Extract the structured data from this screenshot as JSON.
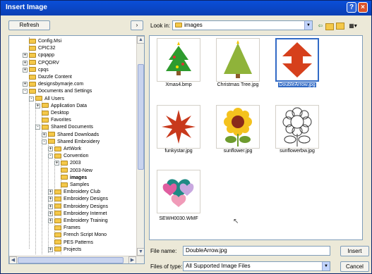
{
  "window": {
    "title": "Insert Image",
    "help_glyph": "?",
    "close_glyph": "×"
  },
  "left": {
    "refresh_label": "Refresh",
    "arrow_glyph": "›"
  },
  "lookin": {
    "label": "Look in:",
    "value": "images"
  },
  "tree": [
    {
      "label": "Config.Msi",
      "indent": 4,
      "expander": ""
    },
    {
      "label": "CPIC32",
      "indent": 4,
      "expander": ""
    },
    {
      "label": "cpqapp",
      "indent": 4,
      "expander": "+"
    },
    {
      "label": "CPQDRV",
      "indent": 4,
      "expander": "+"
    },
    {
      "label": "cpqs",
      "indent": 4,
      "expander": "+"
    },
    {
      "label": "Dazzle Content",
      "indent": 4,
      "expander": ""
    },
    {
      "label": "designsbymarje.com",
      "indent": 4,
      "expander": "+"
    },
    {
      "label": "Documents and Settings",
      "indent": 4,
      "expander": "-"
    },
    {
      "label": "All Users",
      "indent": 5,
      "expander": "-"
    },
    {
      "label": "Application Data",
      "indent": 6,
      "expander": "+"
    },
    {
      "label": "Desktop",
      "indent": 6,
      "expander": ""
    },
    {
      "label": "Favorites",
      "indent": 6,
      "expander": ""
    },
    {
      "label": "Shared Documents",
      "indent": 6,
      "expander": "-"
    },
    {
      "label": "Shared Downloads",
      "indent": 7,
      "expander": "+"
    },
    {
      "label": "Shared Embroidery",
      "indent": 7,
      "expander": "-"
    },
    {
      "label": "ArtWork",
      "indent": 8,
      "expander": "+"
    },
    {
      "label": "Convention",
      "indent": 8,
      "expander": "-"
    },
    {
      "label": "2003",
      "indent": 9,
      "expander": "+"
    },
    {
      "label": "2003-New",
      "indent": 9,
      "expander": ""
    },
    {
      "label": "images",
      "indent": 9,
      "expander": ""
    },
    {
      "label": "Samples",
      "indent": 9,
      "expander": ""
    },
    {
      "label": "Embroidery Club",
      "indent": 8,
      "expander": "+"
    },
    {
      "label": "Embroidery Designs",
      "indent": 8,
      "expander": "+"
    },
    {
      "label": "Embroidery Designs",
      "indent": 8,
      "expander": "+"
    },
    {
      "label": "Embroidery Internet",
      "indent": 8,
      "expander": "+"
    },
    {
      "label": "Embroidery Training",
      "indent": 8,
      "expander": "+"
    },
    {
      "label": "Frames",
      "indent": 8,
      "expander": ""
    },
    {
      "label": "French Script Mono",
      "indent": 8,
      "expander": ""
    },
    {
      "label": "PES Patterns",
      "indent": 8,
      "expander": ""
    },
    {
      "label": "Projects",
      "indent": 8,
      "expander": "+"
    }
  ],
  "files": [
    {
      "name": "Xmas4.bmp",
      "icon": "small-xmas-tree-icon"
    },
    {
      "name": "Christmas Tree.jpg",
      "icon": "christmas-tree-icon"
    },
    {
      "name": "DoubleArrow.jpg",
      "icon": "double-arrow-icon",
      "selected": true
    },
    {
      "name": "funkystar.jpg",
      "icon": "star-icon"
    },
    {
      "name": "sunflower.jpg",
      "icon": "sunflower-icon"
    },
    {
      "name": "sunflowerbw.jpg",
      "icon": "sunflower-outline-icon"
    },
    {
      "name": "SEWH0030.WMF",
      "icon": "hearts-icon"
    }
  ],
  "bottom": {
    "filename_label": "File name:",
    "filename_value": "DoubleArrow.jpg",
    "filetype_label": "Files of type:",
    "filetype_value": "All Supported Image Files",
    "insert_label": "Insert",
    "cancel_label": "Cancel"
  },
  "colors": {
    "titlebar": "#0b47c8",
    "selection": "#316ac5"
  }
}
